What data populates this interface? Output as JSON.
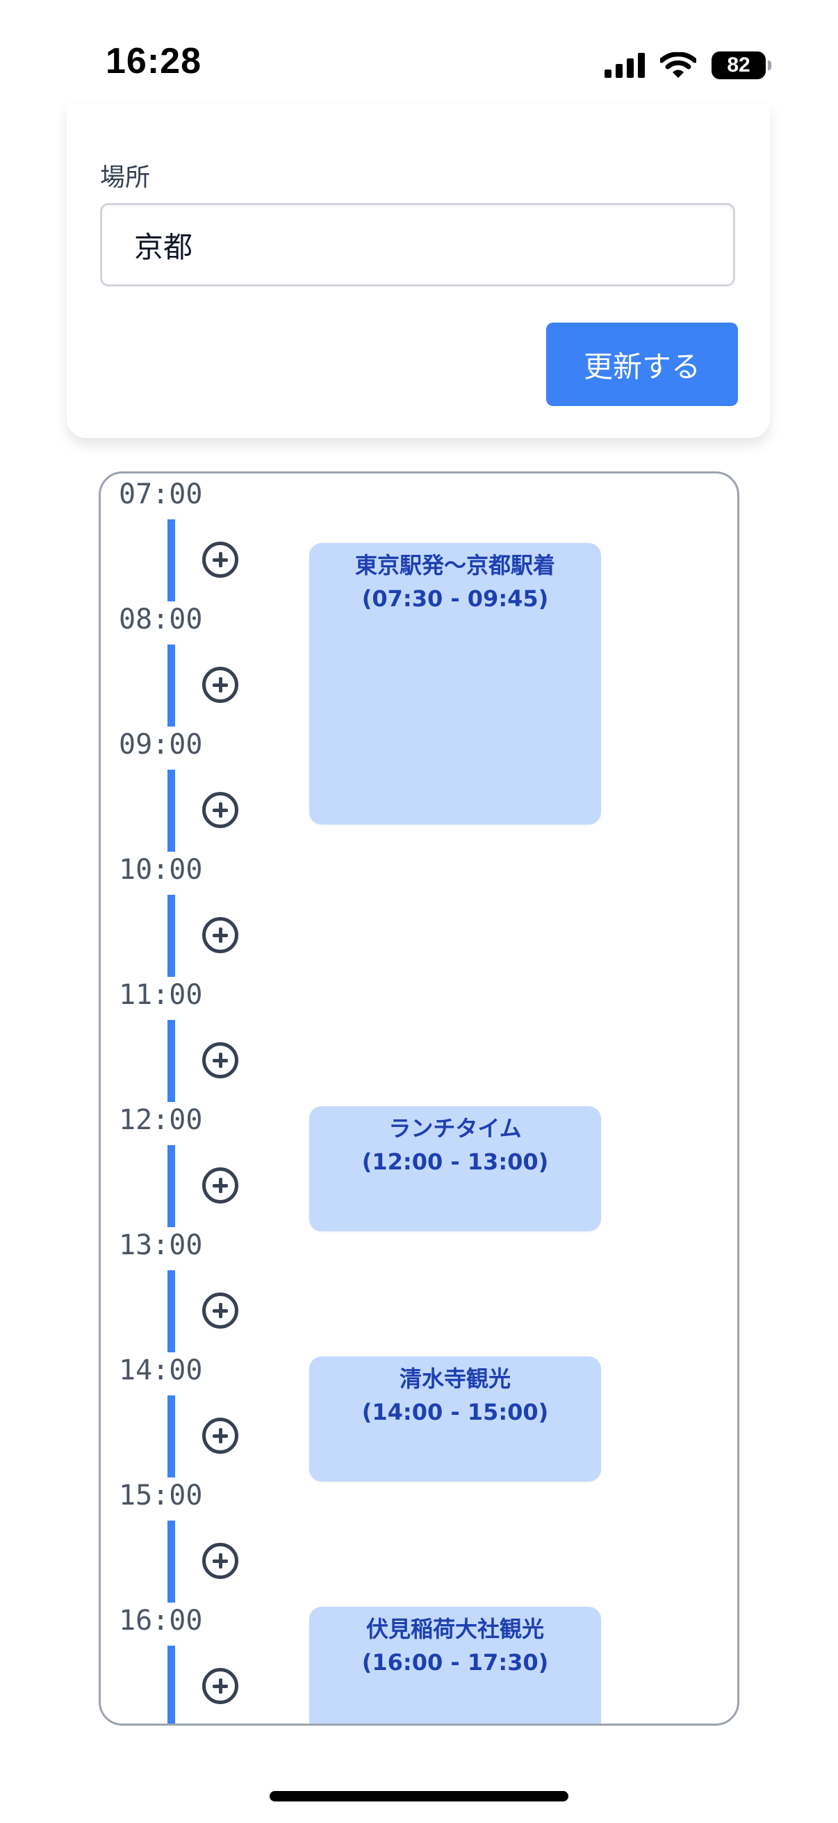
{
  "status_bar": {
    "time": "16:28",
    "battery": "82",
    "icons": [
      "cellular-signal-icon",
      "wifi-icon",
      "battery-icon"
    ]
  },
  "form": {
    "location_label": "場所",
    "location_value": "京都",
    "update_button": "更新する"
  },
  "schedule": {
    "hours": [
      "07:00",
      "08:00",
      "09:00",
      "10:00",
      "11:00",
      "12:00",
      "13:00",
      "14:00",
      "15:00",
      "16:00"
    ],
    "add_icon": "plus-circle-icon",
    "events": [
      {
        "title": "東京駅発〜京都駅着",
        "time": "(07:30 - 09:45)",
        "start": "07:30",
        "end": "09:45"
      },
      {
        "title": "ランチタイム",
        "time": "(12:00 - 13:00)",
        "start": "12:00",
        "end": "13:00"
      },
      {
        "title": "清水寺観光",
        "time": "(14:00 - 15:00)",
        "start": "14:00",
        "end": "15:00"
      },
      {
        "title": "伏見稲荷大社観光",
        "time": "(16:00 - 17:30)",
        "start": "16:00",
        "end": "17:30"
      }
    ]
  },
  "colors": {
    "accent": "#3b82f6",
    "event_bg": "#c3dafd",
    "event_text": "#1e40af",
    "border": "#9ca3af"
  }
}
